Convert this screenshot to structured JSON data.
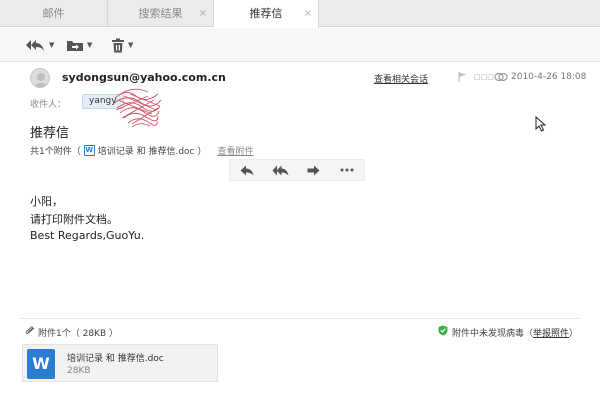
{
  "tabs": [
    {
      "label": "邮件"
    },
    {
      "label": "搜索结果"
    },
    {
      "label": "推荐信"
    }
  ],
  "tab_close_glyph": "×",
  "toolbar": {
    "buttons": [
      {
        "icon": "reply-all-icon",
        "has_menu": true
      },
      {
        "icon": "move-to-folder-icon",
        "has_menu": true
      },
      {
        "icon": "delete-icon",
        "has_menu": true
      }
    ],
    "caret_glyph": "▼"
  },
  "header": {
    "sender": "sydongsun@yahoo.com.cn",
    "view_conversation": "查看相关会话",
    "status_text": "□□□",
    "datetime": "2010-4-26 18:08",
    "recipient_label": "收件人：",
    "recipient": "yangy"
  },
  "subject": "推荐信",
  "attachments_summary": {
    "prefix": "共1个附件（",
    "filename": "培训记录 和 推荐信.doc",
    "suffix": "）",
    "view_link": "查看附件"
  },
  "quick_actions": [
    {
      "icon": "reply-icon"
    },
    {
      "icon": "reply-all-icon"
    },
    {
      "icon": "forward-icon"
    },
    {
      "icon": "more-icon"
    }
  ],
  "body": {
    "line1": "小阳，",
    "line2": "请打印附件文档。",
    "line3": "Best Regards,GuoYu."
  },
  "footer": {
    "attachment_count": "附件1个（ 28KB ）",
    "virus_status": "附件中未发现病毒（",
    "report_link": "举报照件",
    "virus_status_end": "）",
    "file": {
      "name": "培训记录 和 推荐信.doc",
      "size": "28KB",
      "icon_letter": "W"
    }
  },
  "colors": {
    "word_blue": "#2b7cd3",
    "shield_green": "#3fae49"
  }
}
